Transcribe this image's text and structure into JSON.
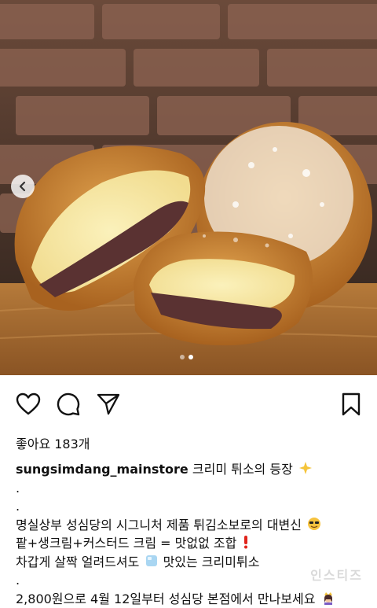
{
  "post": {
    "likes_text": "좋아요 183개",
    "username": "sungsimdang_mainstore",
    "caption_title": "크리미 튀소의 등장",
    "caption_lines": [
      ".",
      ".",
      "명실상부 성심당의 시그니처 제품 튀김소보로의 대변신",
      "팥+생크림+커스터드 크림 = 맛없없 조합",
      "차갑게 살짝 얼려드셔도",
      "맛있는 크리미튀소",
      ".",
      "2,800원으로 4월 12일부터 성심당 본점에서 만나보세요"
    ],
    "watermark": "인스티즈"
  },
  "carousel": {
    "total": 2,
    "active_index": 1
  },
  "icons": {
    "prev": "chevron-left-icon",
    "like": "heart-icon",
    "comment": "comment-icon",
    "share": "paper-plane-icon",
    "save": "bookmark-icon",
    "title_emoji": "sparkle-star-icon",
    "line3_emoji": "sunglasses-face-icon",
    "line4_emoji": "red-exclamation-icon",
    "line5_emoji": "ice-cube-icon",
    "line8_emoji": "woman-with-crown-icon"
  },
  "colors": {
    "text": "#111111",
    "accent_red": "#e0241b",
    "background": "#ffffff"
  }
}
